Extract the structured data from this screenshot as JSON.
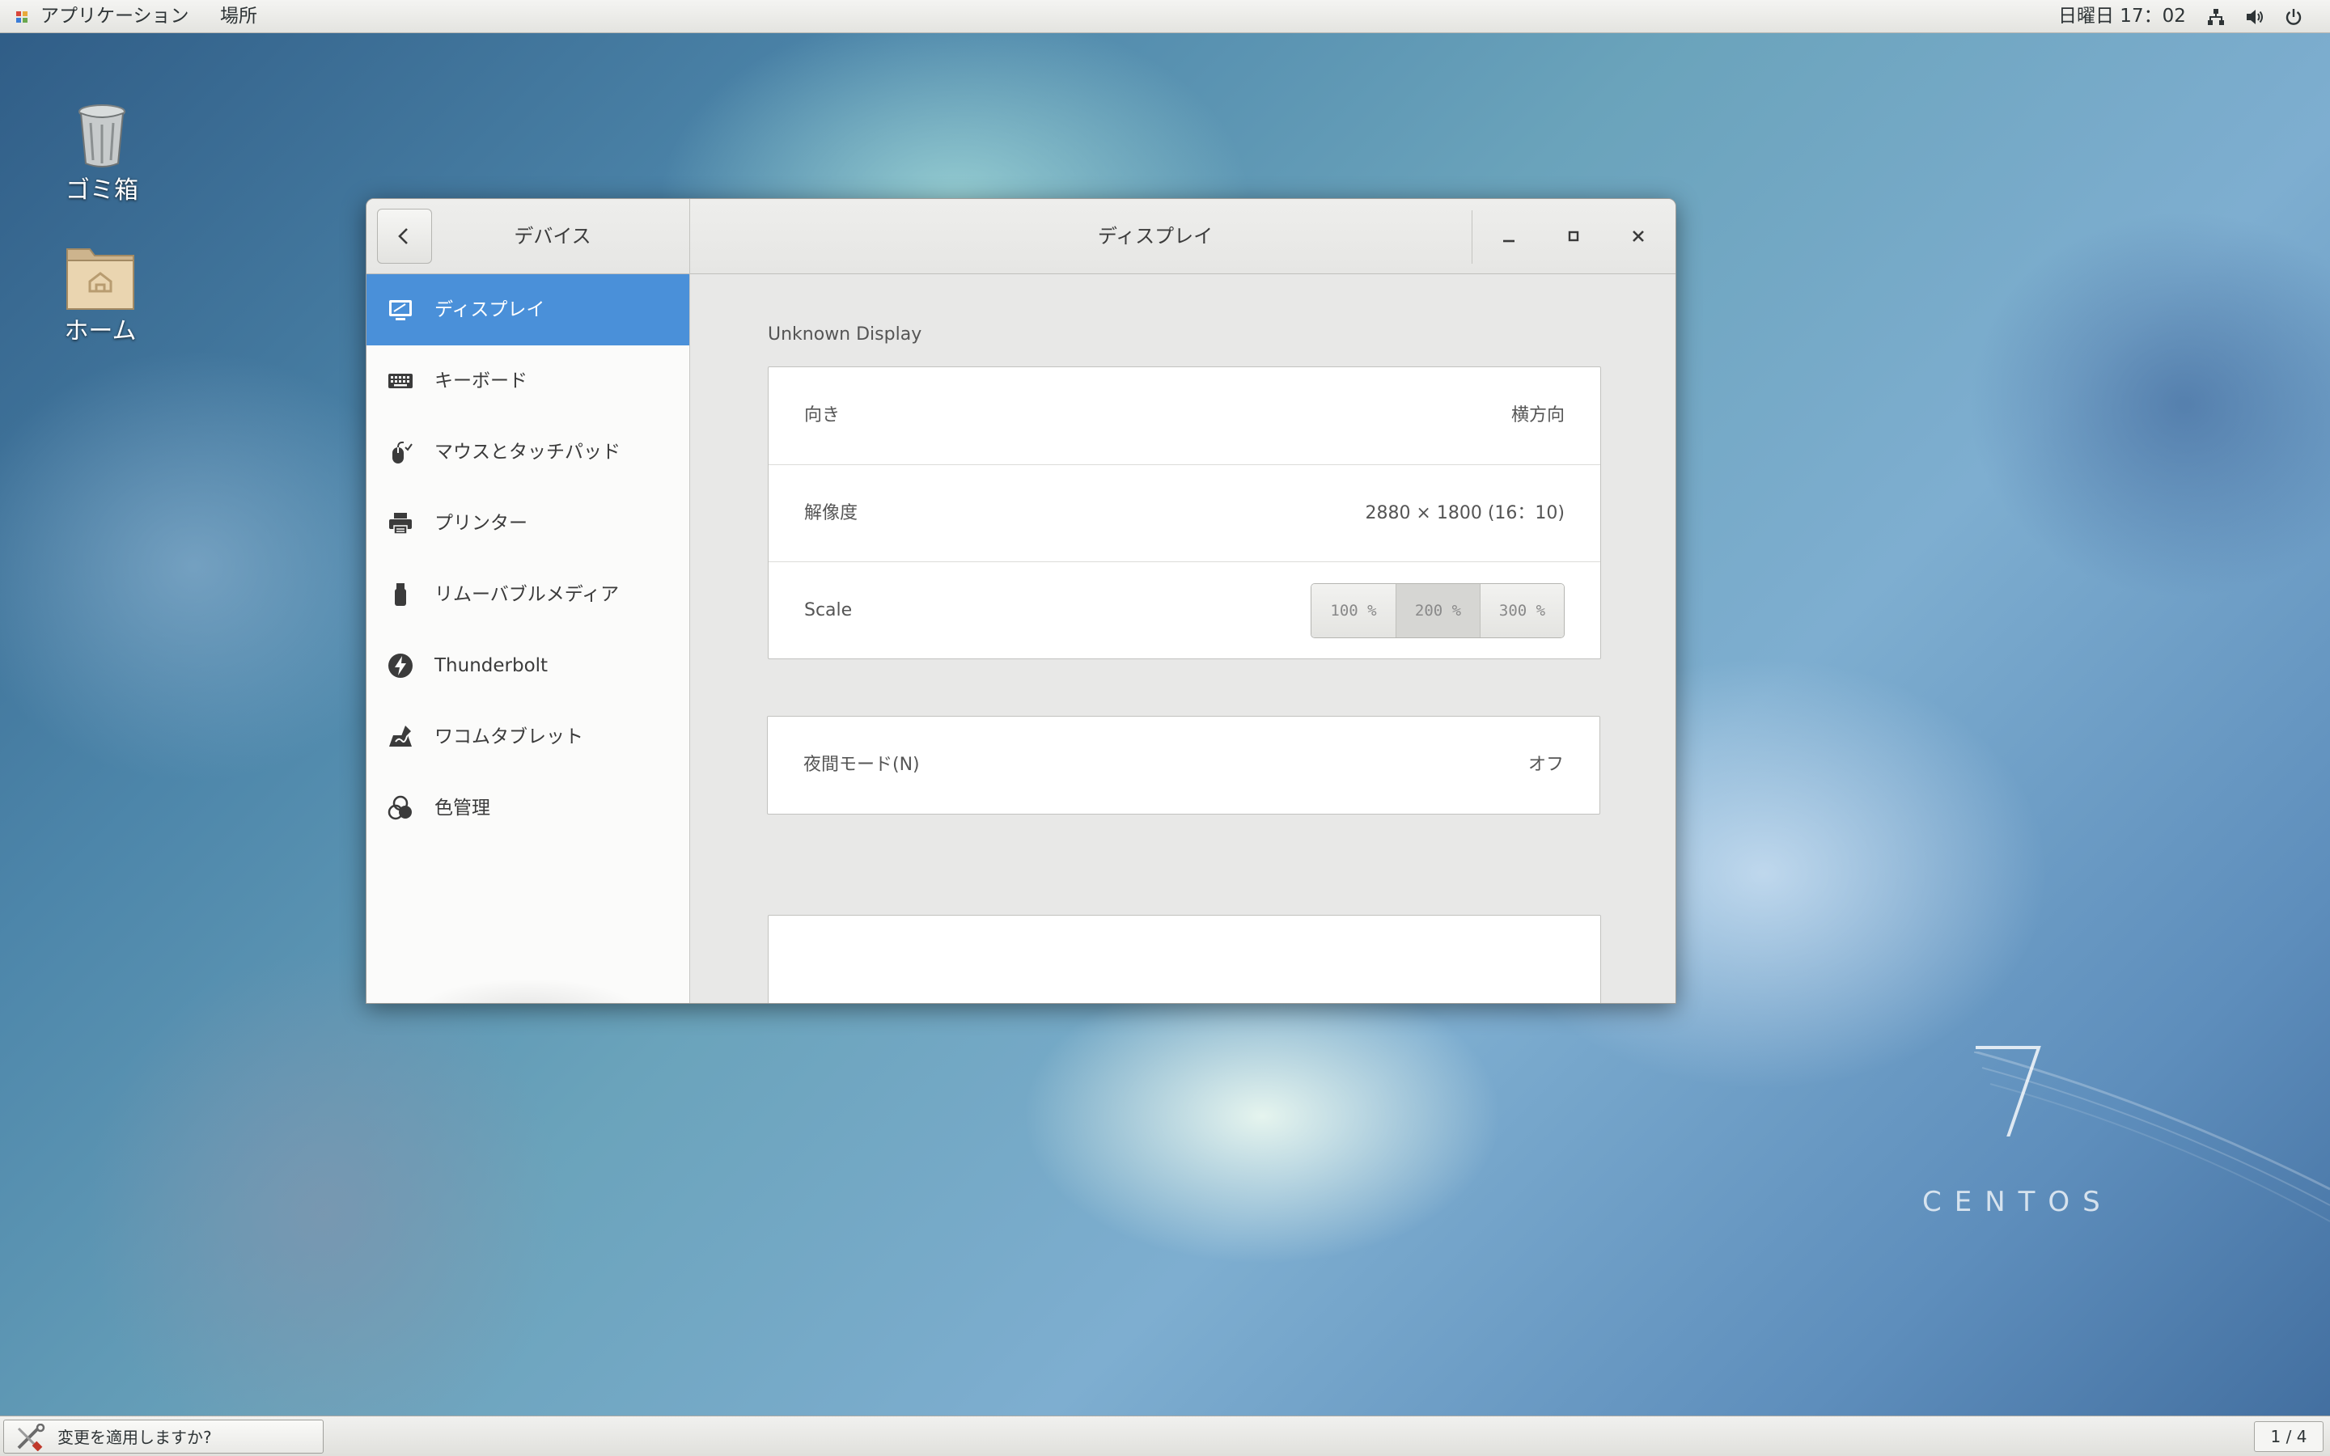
{
  "topbar": {
    "applications": "アプリケーション",
    "places": "場所",
    "clock": "日曜日 17：02",
    "tray_icons": [
      "network-icon",
      "volume-icon",
      "power-icon"
    ]
  },
  "desktop": {
    "icons": [
      {
        "label": "ゴミ箱",
        "icon": "trash-icon"
      },
      {
        "label": "ホーム",
        "icon": "home-folder-icon"
      }
    ],
    "watermark": {
      "number": "7",
      "word": "CENTOS"
    }
  },
  "window": {
    "sidebar_title": "デバイス",
    "title": "ディスプレイ",
    "sidebar": {
      "items": [
        {
          "label": "ディスプレイ",
          "icon": "display-icon",
          "active": true
        },
        {
          "label": "キーボード",
          "icon": "keyboard-icon",
          "active": false
        },
        {
          "label": "マウスとタッチパッド",
          "icon": "mouse-icon",
          "active": false
        },
        {
          "label": "プリンター",
          "icon": "printer-icon",
          "active": false
        },
        {
          "label": "リムーバブルメディア",
          "icon": "usb-drive-icon",
          "active": false
        },
        {
          "label": "Thunderbolt",
          "icon": "thunderbolt-icon",
          "active": false
        },
        {
          "label": "ワコムタブレット",
          "icon": "tablet-icon",
          "active": false
        },
        {
          "label": "色管理",
          "icon": "color-management-icon",
          "active": false
        }
      ]
    },
    "content": {
      "display_name": "Unknown Display",
      "orientation": {
        "label": "向き",
        "value": "横方向"
      },
      "resolution": {
        "label": "解像度",
        "value": "2880 × 1800 (16：10)"
      },
      "scale": {
        "label": "Scale",
        "options": [
          "100 %",
          "200 %",
          "300 %"
        ],
        "selected": "200 %"
      },
      "night_mode": {
        "label": "夜間モード(N)",
        "value": "オフ"
      }
    }
  },
  "bottombar": {
    "task_label": "変更を適用しますか?",
    "workspace": "1 / 4"
  },
  "colors": {
    "accent": "#4a90d9",
    "window_bg": "#e8e8e7",
    "sidebar_bg": "#fbfbfa"
  }
}
